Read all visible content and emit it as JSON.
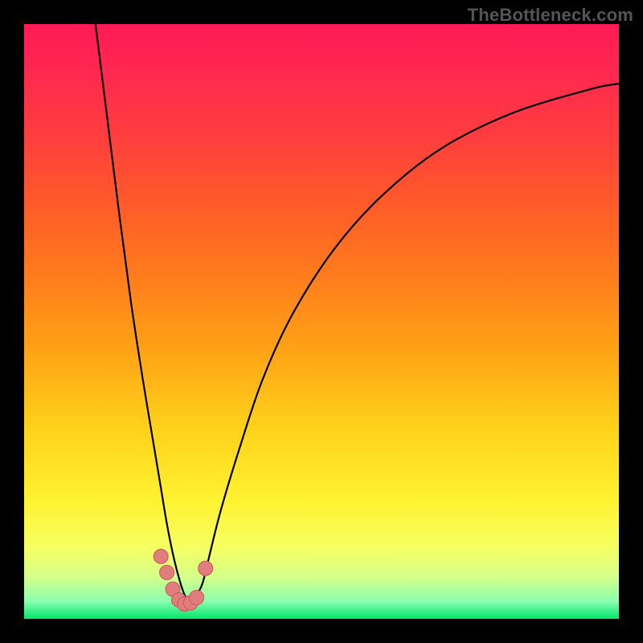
{
  "watermark": "TheBottleneck.com",
  "colors": {
    "frame": "#000000",
    "watermark": "#555555",
    "gradient_stops": [
      {
        "offset": 0.0,
        "color": "#ff1a55"
      },
      {
        "offset": 0.08,
        "color": "#ff2850"
      },
      {
        "offset": 0.18,
        "color": "#ff3b3f"
      },
      {
        "offset": 0.3,
        "color": "#ff5a2a"
      },
      {
        "offset": 0.42,
        "color": "#ff7b1c"
      },
      {
        "offset": 0.55,
        "color": "#ffa315"
      },
      {
        "offset": 0.68,
        "color": "#ffd21a"
      },
      {
        "offset": 0.8,
        "color": "#fff230"
      },
      {
        "offset": 0.88,
        "color": "#f6ff62"
      },
      {
        "offset": 0.93,
        "color": "#d4ff8a"
      },
      {
        "offset": 0.97,
        "color": "#8cffb0"
      },
      {
        "offset": 1.0,
        "color": "#00e56a"
      }
    ],
    "curve": "#000000",
    "marker_fill": "#e27d7d",
    "marker_stroke": "#c85757"
  },
  "chart_data": {
    "type": "line",
    "title": "",
    "xlabel": "",
    "ylabel": "",
    "xlim": [
      0,
      100
    ],
    "ylim": [
      0,
      100
    ],
    "optimum_x": 27,
    "series": [
      {
        "name": "bottleneck-curve",
        "x": [
          12,
          14,
          16,
          18,
          20,
          22,
          23,
          24,
          25,
          26,
          27,
          28,
          29,
          30,
          31,
          33,
          36,
          40,
          45,
          52,
          60,
          70,
          82,
          95,
          100
        ],
        "y": [
          100,
          84,
          68,
          53,
          40,
          28,
          22,
          16,
          11,
          7,
          4,
          3,
          4,
          6,
          10,
          18,
          28,
          40,
          51,
          62,
          71,
          79,
          85,
          89,
          90
        ]
      }
    ],
    "markers": {
      "name": "highlighted-points",
      "x": [
        23.0,
        24.0,
        25.0,
        26.0,
        27.0,
        28.0,
        29.0,
        30.5
      ],
      "y": [
        10.5,
        7.8,
        5.0,
        3.2,
        2.5,
        2.7,
        3.6,
        8.5
      ]
    }
  }
}
